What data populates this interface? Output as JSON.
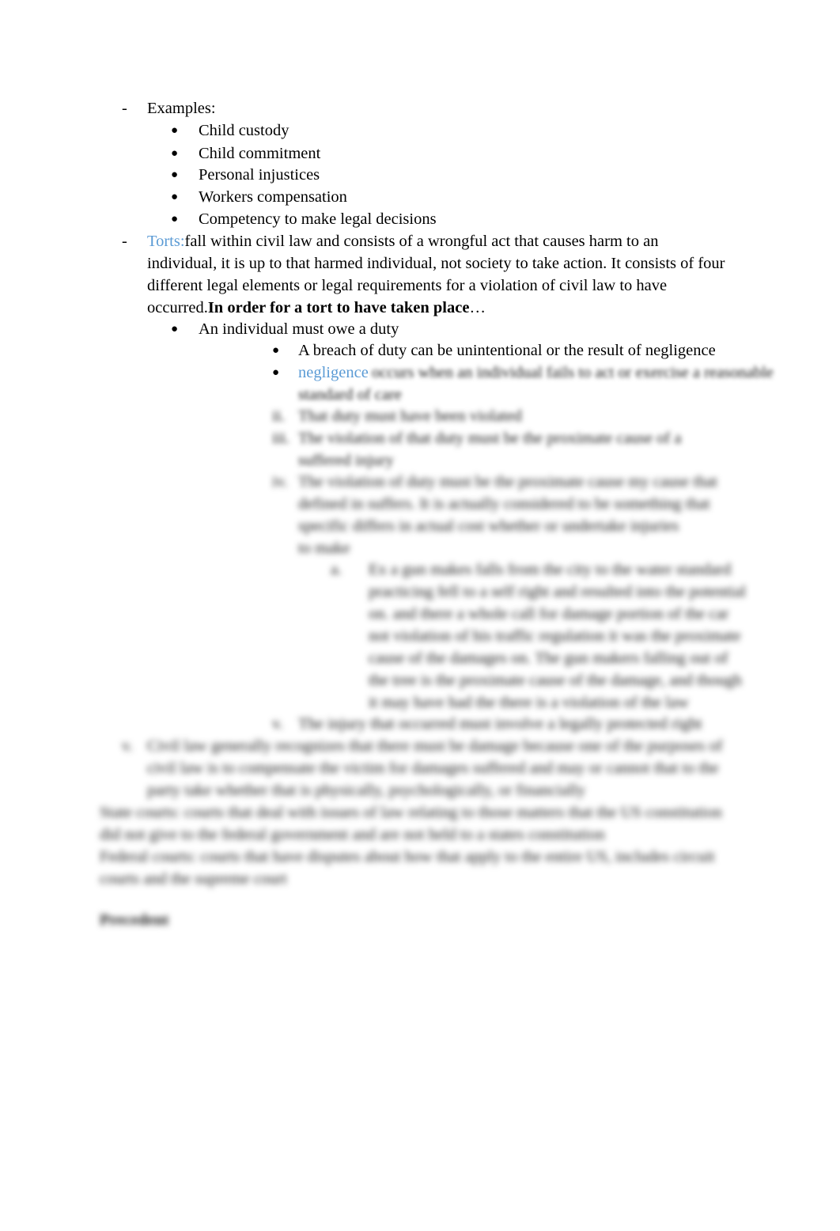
{
  "document": {
    "type": "lecture-notes",
    "page_background": "#ffffff",
    "text_color": "#000000",
    "accent_blue": "#5B9BD5",
    "faded_blue": "#9dc3e6",
    "font_style": "serif",
    "clear_section": {
      "examples_heading": "Examples:",
      "examples_items": [
        "Child custody",
        "Child commitment",
        "Personal injustices",
        "Workers compensation",
        "Competency to make legal decisions"
      ],
      "torts": {
        "term": "Torts:",
        "body_lines": [
          "fall within civil law and consists of a wrongful act that causes harm to an",
          "individual, it is up to that harmed individual, not society to take action. It consists of four",
          "different legal elements or legal requirements for a violation of civil law to have",
          "occurred."
        ],
        "bold_tail": "In order for a tort to have taken place",
        "ellipsis": "…"
      },
      "duty_item": "An individual must owe a duty",
      "breach_item": "A breach of duty can be unintentional or the result of negligence",
      "negligence_term": "negligence"
    },
    "blurred_section": {
      "note": "Remaining body text is out of focus in the scan and not legible.",
      "lines": [
        {
          "id": "neg-def-1",
          "marker": "",
          "text": "occurs when an individual fails to act or exercise a reasonable"
        },
        {
          "id": "neg-def-2",
          "marker": "",
          "text": "standard of care"
        },
        {
          "id": "item-ii",
          "marker": "ii.",
          "text": "That duty must have been violated"
        },
        {
          "id": "item-iii-1",
          "marker": "iii.",
          "text": "The violation of that duty must be the proximate cause of a"
        },
        {
          "id": "item-iii-2",
          "marker": "",
          "text": "suffered injury"
        },
        {
          "id": "item-iv-1",
          "marker": "iv.",
          "text": "The violation of duty must be the proximate cause my cause that"
        },
        {
          "id": "item-iv-2",
          "marker": "",
          "text": "defined in suffers. It is actually considered to be something that"
        },
        {
          "id": "item-iv-3",
          "marker": "",
          "text": "specific differs in actual cost whether or undertake injuries"
        },
        {
          "id": "item-iv-4",
          "marker": "",
          "text": "to make"
        },
        {
          "id": "sub-a-1",
          "marker": "a.",
          "text": "Ex a gun makes falls from the city to the water standard"
        },
        {
          "id": "sub-a-2",
          "marker": "",
          "text": "practicing fell to a self right and resulted into the potential"
        },
        {
          "id": "sub-a-3",
          "marker": "",
          "text": "on. and there a whole call for damage portion of the car"
        },
        {
          "id": "sub-a-4",
          "marker": "",
          "text": "not violation of his traffic regulation it was the proximate"
        },
        {
          "id": "sub-a-5",
          "marker": "",
          "text": "cause of the damages on. The gun makers falling out of"
        },
        {
          "id": "sub-a-6",
          "marker": "",
          "text": "the tree is the proximate cause of the damage, and though"
        },
        {
          "id": "sub-a-7",
          "marker": "",
          "text": "it may have had the there is a violation of the law"
        },
        {
          "id": "item-v",
          "marker": "v.",
          "text": "The injury that occurred must involve a legally protected right"
        },
        {
          "id": "civil-1",
          "marker": "v.",
          "text": "Civil law generally recognizes that there must be damage because one of the purposes of"
        },
        {
          "id": "civil-2",
          "marker": "",
          "text": "civil law is to compensate the victim for damages suffered and may or cannot that to the"
        },
        {
          "id": "civil-3",
          "marker": "",
          "text": "party take  whether that is physically, psychologically, or financially"
        },
        {
          "id": "term-1",
          "marker": "",
          "term": "State courts",
          "text": ": courts that deal with issues of law relating to those matters that the US constitution",
          "blue": true
        },
        {
          "id": "term-1b",
          "marker": "",
          "text": "did not give to the federal government and are not held to a states constitution"
        },
        {
          "id": "term-2",
          "marker": "",
          "term": "Federal courts",
          "text": ": courts that have disputes about how that apply to the entire US, includes circuit",
          "blue": true
        },
        {
          "id": "term-2b",
          "marker": "",
          "text": "courts and the supreme court"
        },
        {
          "id": "heading-bottom",
          "marker": "",
          "text": "Precedent",
          "bold": true
        }
      ]
    }
  }
}
